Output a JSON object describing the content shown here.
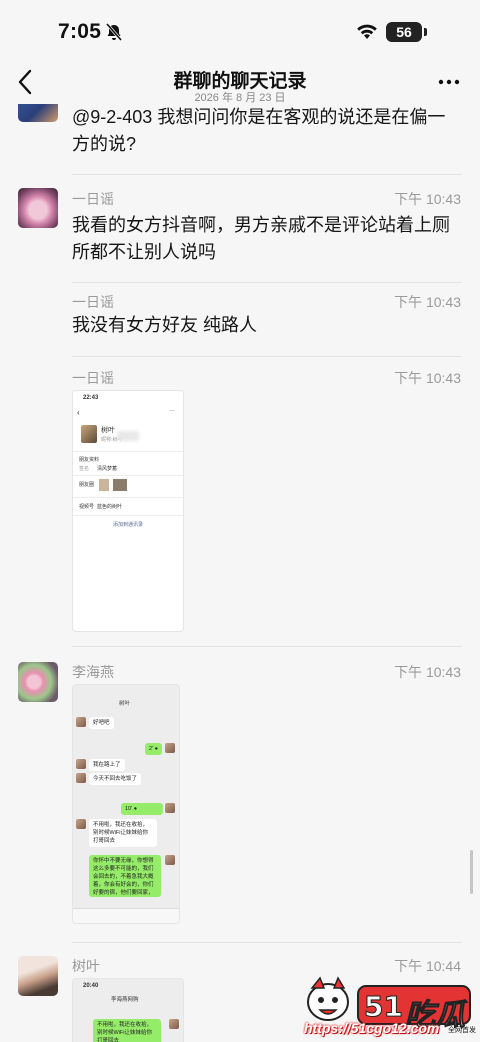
{
  "status": {
    "time": "7:05",
    "battery": "56"
  },
  "nav": {
    "title": "群聊的聊天记录",
    "subtitle": "2026 年 8 月 23 日"
  },
  "messages": [
    {
      "text": "@9-2-403 我想问问你是在客观的说还是在偏一方的说?"
    },
    {
      "sender": "一日谣",
      "time": "下午 10:43",
      "text": "我看的女方抖音啊，男方亲戚不是评论站着上厕所都不让别人说吗"
    },
    {
      "sender": "一日谣",
      "time": "下午 10:43",
      "text": "我没有女方好友 纯路人"
    },
    {
      "sender": "一日谣",
      "time": "下午 10:43"
    },
    {
      "sender": "李海燕",
      "time": "下午 10:43"
    },
    {
      "sender": "树叶",
      "time": "下午 10:44"
    }
  ],
  "shot1": {
    "time": "22:43",
    "name": "树叶",
    "sub": "昵称:树叶",
    "row1": "朋友资料",
    "row2a": "签名",
    "row2b": "清风梦蓄",
    "row3": "朋友圈",
    "row4a": "视频号",
    "row4b": "蓝色的树叶",
    "button": "添加到通讯录"
  },
  "shot2": {
    "title": "树叶",
    "b1": "好吧吧",
    "b2": "2' ●",
    "b3": "我在路上了",
    "b4": "今天不回去吃饭了",
    "b5": "10' ●",
    "b6": "不用啦，我还在收拾，别时候WiFi让妹妹给你打哥回去",
    "b7": "你怀中不要无缘，你想得这么多要不可能的，我们会回去的，不着急我大概着，你会有好会的，你们好要的宿，他们要回家，你们会好的想了，我们会好的。"
  },
  "shot3": {
    "time": "20:40",
    "title": "李海燕网购",
    "b1": "不用啦，我还在收拾，别时候WiFi让妹妹给你打哥回去"
  },
  "watermark": {
    "logo": "吃瓜",
    "url": "https://51cgo12.com"
  }
}
